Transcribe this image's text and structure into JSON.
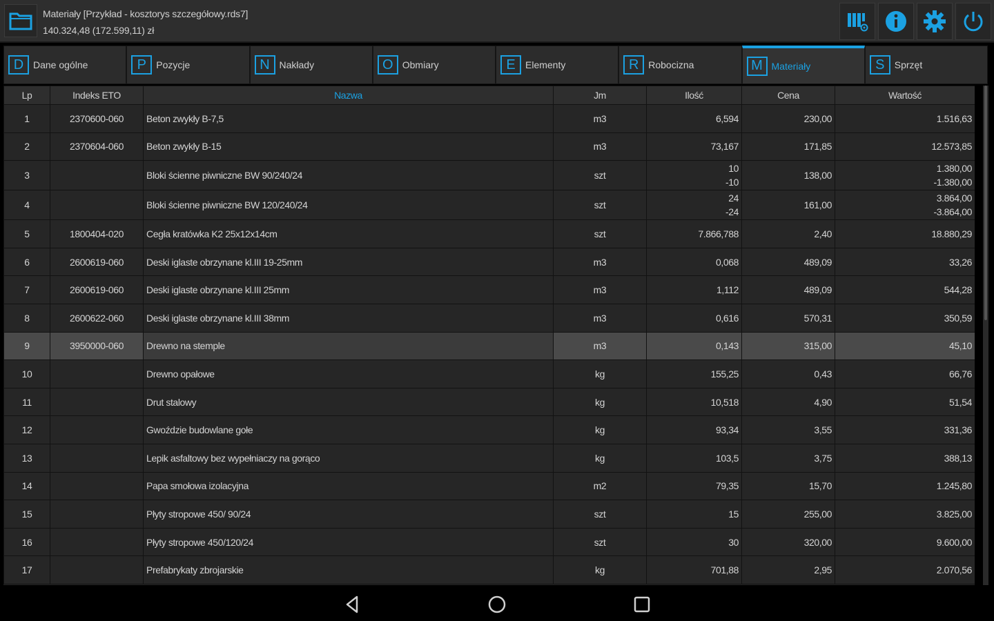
{
  "header": {
    "title_line1": "Materiały [Przykład - kosztorys szczegółowy.rds7]",
    "title_line2": "140.324,48 (172.599,11) zł",
    "icons": [
      "folder-icon",
      "columns-settings-icon",
      "info-icon",
      "gear-icon",
      "power-icon"
    ],
    "accent_color": "#1ba1e2"
  },
  "tabs": [
    {
      "key": "D",
      "label": "Dane ogólne",
      "active": false
    },
    {
      "key": "P",
      "label": "Pozycje",
      "active": false
    },
    {
      "key": "N",
      "label": "Nakłady",
      "active": false
    },
    {
      "key": "O",
      "label": "Obmiary",
      "active": false
    },
    {
      "key": "E",
      "label": "Elementy",
      "active": false
    },
    {
      "key": "R",
      "label": "Robocizna",
      "active": false
    },
    {
      "key": "M",
      "label": "Materiały",
      "active": true
    },
    {
      "key": "S",
      "label": "Sprzęt",
      "active": false
    }
  ],
  "table": {
    "columns": [
      "Lp",
      "Indeks ETO",
      "Nazwa",
      "Jm",
      "Ilość",
      "Cena",
      "Wartość"
    ],
    "sort_column": "Nazwa",
    "selected_row": "9",
    "rows": [
      {
        "lp": "1",
        "indeks": "2370600-060",
        "nazwa": "Beton zwykły B-7,5",
        "jm": "m3",
        "ilosc": "6,594",
        "ilosc2": "",
        "cena": "230,00",
        "wartosc": "1.516,63",
        "wartosc2": ""
      },
      {
        "lp": "2",
        "indeks": "2370604-060",
        "nazwa": "Beton zwykły B-15",
        "jm": "m3",
        "ilosc": "73,167",
        "ilosc2": "",
        "cena": "171,85",
        "wartosc": "12.573,85",
        "wartosc2": ""
      },
      {
        "lp": "3",
        "indeks": "",
        "nazwa": "Bloki ścienne piwniczne BW 90/240/24",
        "jm": "szt",
        "ilosc": "10",
        "ilosc2": "-10",
        "cena": "138,00",
        "wartosc": "1.380,00",
        "wartosc2": "-1.380,00"
      },
      {
        "lp": "4",
        "indeks": "",
        "nazwa": "Bloki ścienne piwniczne BW 120/240/24",
        "jm": "szt",
        "ilosc": "24",
        "ilosc2": "-24",
        "cena": "161,00",
        "wartosc": "3.864,00",
        "wartosc2": "-3.864,00"
      },
      {
        "lp": "5",
        "indeks": "1800404-020",
        "nazwa": "Cegła kratówka K2 25x12x14cm",
        "jm": "szt",
        "ilosc": "7.866,788",
        "ilosc2": "",
        "cena": "2,40",
        "wartosc": "18.880,29",
        "wartosc2": ""
      },
      {
        "lp": "6",
        "indeks": "2600619-060",
        "nazwa": "Deski iglaste obrzynane kl.III 19-25mm",
        "jm": "m3",
        "ilosc": "0,068",
        "ilosc2": "",
        "cena": "489,09",
        "wartosc": "33,26",
        "wartosc2": ""
      },
      {
        "lp": "7",
        "indeks": "2600619-060",
        "nazwa": "Deski iglaste obrzynane kl.III 25mm",
        "jm": "m3",
        "ilosc": "1,112",
        "ilosc2": "",
        "cena": "489,09",
        "wartosc": "544,28",
        "wartosc2": ""
      },
      {
        "lp": "8",
        "indeks": "2600622-060",
        "nazwa": "Deski iglaste obrzynane kl.III 38mm",
        "jm": "m3",
        "ilosc": "0,616",
        "ilosc2": "",
        "cena": "570,31",
        "wartosc": "350,59",
        "wartosc2": ""
      },
      {
        "lp": "9",
        "indeks": "3950000-060",
        "nazwa": "Drewno na stemple",
        "jm": "m3",
        "ilosc": "0,143",
        "ilosc2": "",
        "cena": "315,00",
        "wartosc": "45,10",
        "wartosc2": ""
      },
      {
        "lp": "10",
        "indeks": "",
        "nazwa": "Drewno opałowe",
        "jm": "kg",
        "ilosc": "155,25",
        "ilosc2": "",
        "cena": "0,43",
        "wartosc": "66,76",
        "wartosc2": ""
      },
      {
        "lp": "11",
        "indeks": "",
        "nazwa": "Drut stalowy",
        "jm": "kg",
        "ilosc": "10,518",
        "ilosc2": "",
        "cena": "4,90",
        "wartosc": "51,54",
        "wartosc2": ""
      },
      {
        "lp": "12",
        "indeks": "",
        "nazwa": "Gwoździe budowlane gołe",
        "jm": "kg",
        "ilosc": "93,34",
        "ilosc2": "",
        "cena": "3,55",
        "wartosc": "331,36",
        "wartosc2": ""
      },
      {
        "lp": "13",
        "indeks": "",
        "nazwa": "Lepik asfaltowy bez wypełniaczy na gorąco",
        "jm": "kg",
        "ilosc": "103,5",
        "ilosc2": "",
        "cena": "3,75",
        "wartosc": "388,13",
        "wartosc2": ""
      },
      {
        "lp": "14",
        "indeks": "",
        "nazwa": "Papa smołowa izolacyjna",
        "jm": "m2",
        "ilosc": "79,35",
        "ilosc2": "",
        "cena": "15,70",
        "wartosc": "1.245,80",
        "wartosc2": ""
      },
      {
        "lp": "15",
        "indeks": "",
        "nazwa": "Płyty stropowe 450/ 90/24",
        "jm": "szt",
        "ilosc": "15",
        "ilosc2": "",
        "cena": "255,00",
        "wartosc": "3.825,00",
        "wartosc2": ""
      },
      {
        "lp": "16",
        "indeks": "",
        "nazwa": "Płyty stropowe 450/120/24",
        "jm": "szt",
        "ilosc": "30",
        "ilosc2": "",
        "cena": "320,00",
        "wartosc": "9.600,00",
        "wartosc2": ""
      },
      {
        "lp": "17",
        "indeks": "",
        "nazwa": "Prefabrykaty zbrojarskie",
        "jm": "kg",
        "ilosc": "701,88",
        "ilosc2": "",
        "cena": "2,95",
        "wartosc": "2.070,56",
        "wartosc2": ""
      }
    ]
  },
  "navbar": {
    "icons": [
      "back-icon",
      "home-icon",
      "recents-icon"
    ]
  }
}
